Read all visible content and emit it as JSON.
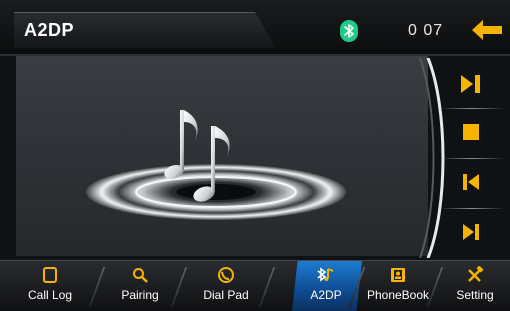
{
  "header": {
    "title": "A2DP",
    "time": "0 07",
    "bluetooth_icon": "bluetooth-icon",
    "back_icon": "back-arrow-icon"
  },
  "main": {
    "artwork_icon": "music-note-disc-icon"
  },
  "controls": [
    {
      "name": "play-pause",
      "icon": "play-pause-icon"
    },
    {
      "name": "stop",
      "icon": "stop-icon"
    },
    {
      "name": "previous",
      "icon": "skip-previous-icon"
    },
    {
      "name": "next",
      "icon": "skip-next-icon"
    }
  ],
  "nav": {
    "active": "A2DP",
    "items": [
      {
        "label": "Call Log",
        "icon": "call-log-icon"
      },
      {
        "label": "Pairing",
        "icon": "search-icon"
      },
      {
        "label": "Dial Pad",
        "icon": "dial-pad-icon"
      },
      {
        "label": "A2DP",
        "icon": "a2dp-icon"
      },
      {
        "label": "PhoneBook",
        "icon": "phonebook-icon"
      },
      {
        "label": "Setting",
        "icon": "settings-tools-icon"
      }
    ]
  },
  "colors": {
    "accent_yellow": "#f5b400",
    "active_blue": "#1a6fc2",
    "bluetooth_green": "#1ecb8a"
  }
}
